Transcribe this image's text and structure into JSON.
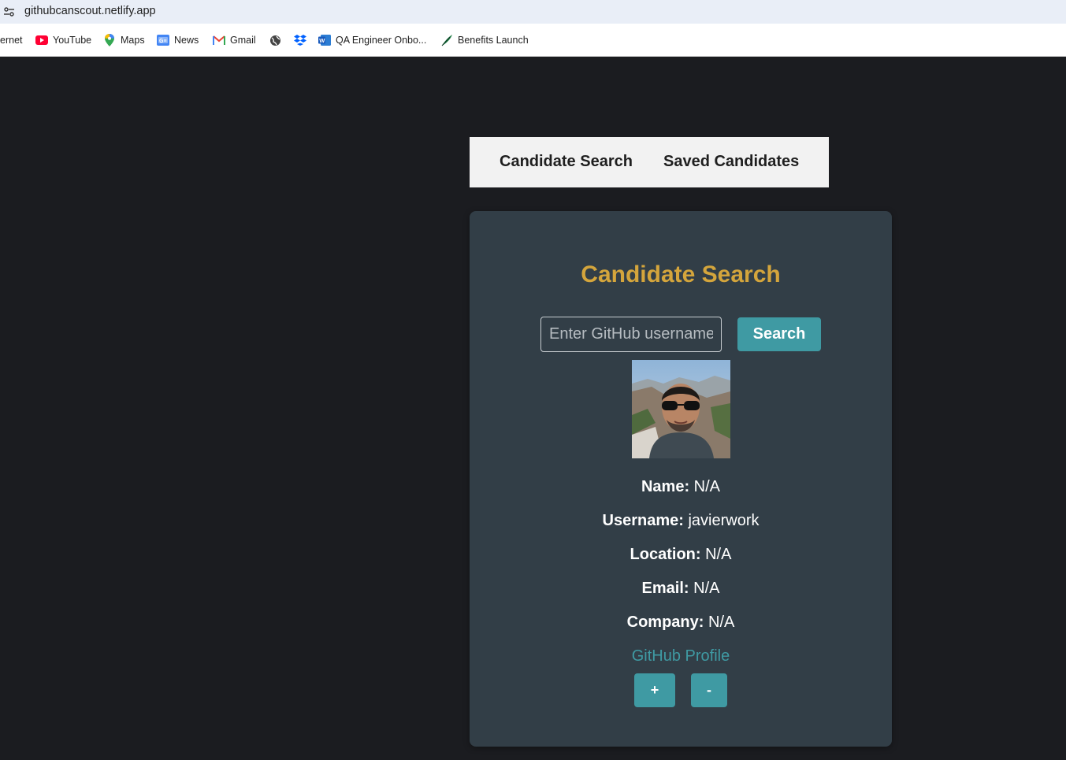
{
  "browser": {
    "url": "githubcanscout.netlify.app",
    "bookmarks": [
      {
        "label": "ernet",
        "icon": "none"
      },
      {
        "label": "YouTube",
        "icon": "youtube-icon"
      },
      {
        "label": "Maps",
        "icon": "maps-pin-icon"
      },
      {
        "label": "News",
        "icon": "google-news-icon"
      },
      {
        "label": "Gmail",
        "icon": "gmail-icon"
      },
      {
        "label": "",
        "icon": "globe-icon"
      },
      {
        "label": "",
        "icon": "dropbox-icon"
      },
      {
        "label": "QA Engineer Onbo...",
        "icon": "word-icon"
      },
      {
        "label": "Benefits Launch",
        "icon": "feather-icon"
      }
    ]
  },
  "nav": {
    "candidate_search": "Candidate Search",
    "saved_candidates": "Saved Candidates"
  },
  "card": {
    "title": "Candidate Search",
    "search": {
      "placeholder": "Enter GitHub username",
      "value": "",
      "button_label": "Search"
    },
    "candidate": {
      "name_label": "Name:",
      "name_value": "N/A",
      "username_label": "Username:",
      "username_value": "javierwork",
      "location_label": "Location:",
      "location_value": "N/A",
      "email_label": "Email:",
      "email_value": "N/A",
      "company_label": "Company:",
      "company_value": "N/A",
      "profile_link": "GitHub Profile"
    },
    "actions": {
      "add_label": "+",
      "remove_label": "-"
    }
  },
  "colors": {
    "page_bg": "#1b1c20",
    "card_bg": "#323e47",
    "title_gold": "#d4a53c",
    "accent_teal": "#3f9aa3",
    "nav_bg": "#f2f2f2"
  }
}
